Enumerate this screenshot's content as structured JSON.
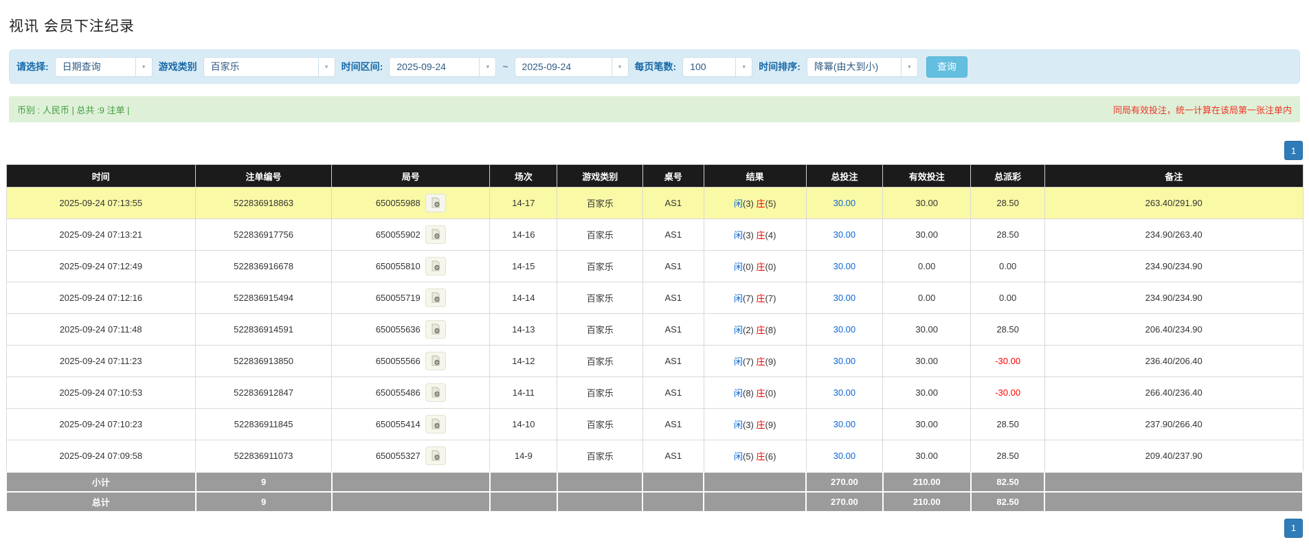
{
  "page": {
    "title": "视讯 会员下注纪录"
  },
  "filters": {
    "select_label": "请选择:",
    "select_value": "日期查询",
    "game_label": "游戏类别",
    "game_value": "百家乐",
    "range_label": "时间区间:",
    "date_from": "2025-09-24",
    "range_separator": "~",
    "date_to": "2025-09-24",
    "per_page_label": "每页笔数:",
    "per_page_value": "100",
    "sort_label": "时间排序:",
    "sort_value": "降幂(由大到小)",
    "search_button": "查询"
  },
  "info_bar": {
    "left": "币别 : 人民币 | 总共 :9 注单 |",
    "right": "同局有效投注，统一计算在该局第一张注单内"
  },
  "pagination": {
    "current_page": "1"
  },
  "table": {
    "headers": [
      "时间",
      "注单编号",
      "局号",
      "场次",
      "游戏类别",
      "桌号",
      "结果",
      "总投注",
      "有效投注",
      "总派彩",
      "备注"
    ],
    "rows": [
      {
        "time": "2025-09-24 07:13:55",
        "bet_id": "522836918863",
        "round_no": "650055988",
        "session": "14-17",
        "game": "百家乐",
        "table_no": "AS1",
        "result": {
          "player": "闲",
          "player_score": "(3)",
          "banker": "庄",
          "banker_score": "(5)"
        },
        "total_bet": "30.00",
        "valid_bet": "30.00",
        "payout": "28.50",
        "remark": "263.40/291.90",
        "highlight": true
      },
      {
        "time": "2025-09-24 07:13:21",
        "bet_id": "522836917756",
        "round_no": "650055902",
        "session": "14-16",
        "game": "百家乐",
        "table_no": "AS1",
        "result": {
          "player": "闲",
          "player_score": "(3)",
          "banker": "庄",
          "banker_score": "(4)"
        },
        "total_bet": "30.00",
        "valid_bet": "30.00",
        "payout": "28.50",
        "remark": "234.90/263.40",
        "highlight": false
      },
      {
        "time": "2025-09-24 07:12:49",
        "bet_id": "522836916678",
        "round_no": "650055810",
        "session": "14-15",
        "game": "百家乐",
        "table_no": "AS1",
        "result": {
          "player": "闲",
          "player_score": "(0)",
          "banker": "庄",
          "banker_score": "(0)"
        },
        "total_bet": "30.00",
        "valid_bet": "0.00",
        "payout": "0.00",
        "remark": "234.90/234.90",
        "highlight": false
      },
      {
        "time": "2025-09-24 07:12:16",
        "bet_id": "522836915494",
        "round_no": "650055719",
        "session": "14-14",
        "game": "百家乐",
        "table_no": "AS1",
        "result": {
          "player": "闲",
          "player_score": "(7)",
          "banker": "庄",
          "banker_score": "(7)"
        },
        "total_bet": "30.00",
        "valid_bet": "0.00",
        "payout": "0.00",
        "remark": "234.90/234.90",
        "highlight": false
      },
      {
        "time": "2025-09-24 07:11:48",
        "bet_id": "522836914591",
        "round_no": "650055636",
        "session": "14-13",
        "game": "百家乐",
        "table_no": "AS1",
        "result": {
          "player": "闲",
          "player_score": "(2)",
          "banker": "庄",
          "banker_score": "(8)"
        },
        "total_bet": "30.00",
        "valid_bet": "30.00",
        "payout": "28.50",
        "remark": "206.40/234.90",
        "highlight": false
      },
      {
        "time": "2025-09-24 07:11:23",
        "bet_id": "522836913850",
        "round_no": "650055566",
        "session": "14-12",
        "game": "百家乐",
        "table_no": "AS1",
        "result": {
          "player": "闲",
          "player_score": "(7)",
          "banker": "庄",
          "banker_score": "(9)"
        },
        "total_bet": "30.00",
        "valid_bet": "30.00",
        "payout": "-30.00",
        "remark": "236.40/206.40",
        "highlight": false
      },
      {
        "time": "2025-09-24 07:10:53",
        "bet_id": "522836912847",
        "round_no": "650055486",
        "session": "14-11",
        "game": "百家乐",
        "table_no": "AS1",
        "result": {
          "player": "闲",
          "player_score": "(8)",
          "banker": "庄",
          "banker_score": "(0)"
        },
        "total_bet": "30.00",
        "valid_bet": "30.00",
        "payout": "-30.00",
        "remark": "266.40/236.40",
        "highlight": false
      },
      {
        "time": "2025-09-24 07:10:23",
        "bet_id": "522836911845",
        "round_no": "650055414",
        "session": "14-10",
        "game": "百家乐",
        "table_no": "AS1",
        "result": {
          "player": "闲",
          "player_score": "(3)",
          "banker": "庄",
          "banker_score": "(9)"
        },
        "total_bet": "30.00",
        "valid_bet": "30.00",
        "payout": "28.50",
        "remark": "237.90/266.40",
        "highlight": false
      },
      {
        "time": "2025-09-24 07:09:58",
        "bet_id": "522836911073",
        "round_no": "650055327",
        "session": "14-9",
        "game": "百家乐",
        "table_no": "AS1",
        "result": {
          "player": "闲",
          "player_score": "(5)",
          "banker": "庄",
          "banker_score": "(6)"
        },
        "total_bet": "30.00",
        "valid_bet": "30.00",
        "payout": "28.50",
        "remark": "209.40/237.90",
        "highlight": false
      }
    ],
    "subtotal": {
      "label": "小计",
      "count": "9",
      "total_bet": "270.00",
      "valid_bet": "210.00",
      "payout": "82.50"
    },
    "total": {
      "label": "总计",
      "count": "9",
      "total_bet": "270.00",
      "valid_bet": "210.00",
      "payout": "82.50"
    }
  },
  "icons": {
    "chevron_down": "▾",
    "video_replay": "film-document"
  },
  "colors": {
    "player_blue": "#0b66d6",
    "banker_red": "#e60000",
    "link_blue": "#0b66d6",
    "negative_red": "#ff0000",
    "highlight_yellow": "#f9f9a6",
    "header_bg": "#1b1b1b",
    "summary_bg": "#9b9b9b",
    "pager_blue": "#2e7cb8",
    "filter_bg": "#d9ecf6",
    "info_bg": "#dff0d8",
    "info_green": "#3f9e3f",
    "notice_red": "#ee3524",
    "search_btn_blue": "#64bedf"
  }
}
